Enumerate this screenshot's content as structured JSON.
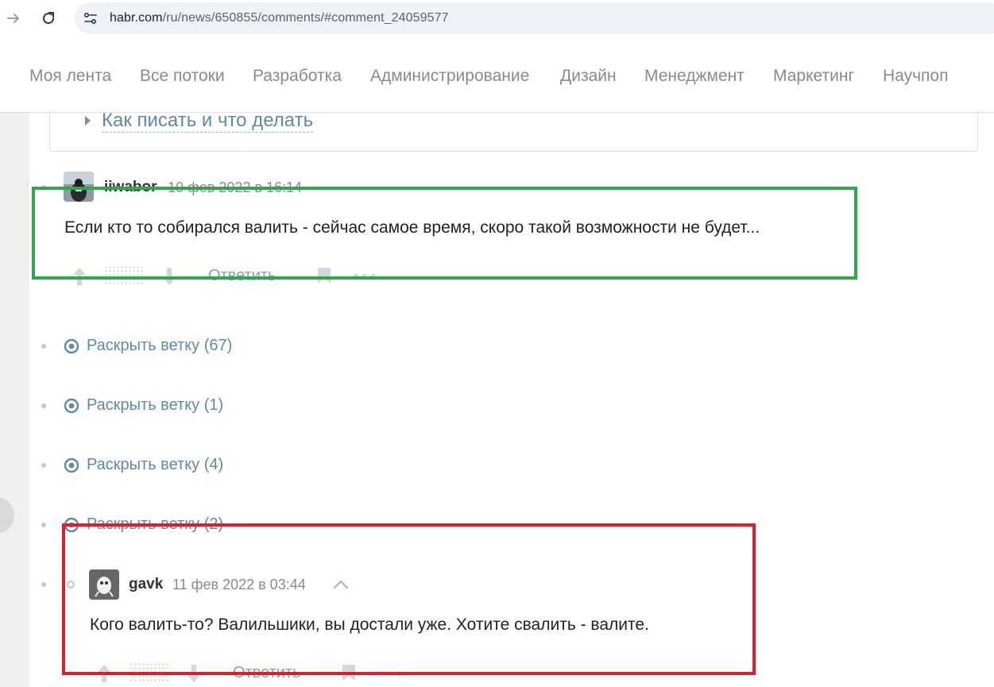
{
  "browser": {
    "url_host": "habr.com",
    "url_path": "/ru/news/650855/comments/#comment_24059577"
  },
  "site_nav": {
    "items": [
      "Моя лента",
      "Все потоки",
      "Разработка",
      "Администрирование",
      "Дизайн",
      "Менеджмент",
      "Маркетинг",
      "Научпоп"
    ]
  },
  "rules": {
    "link_label": "Как писать и что делать"
  },
  "comments": [
    {
      "author": "iiwabor",
      "date": "10 фев 2022 в 16:14",
      "text": "Если кто то собирался валить - сейчас самое время, скоро такой возможности не будет...",
      "reply_label": "Ответить"
    },
    {
      "author": "gavk",
      "date": "11 фев 2022 в 03:44",
      "text": "Кого валить-то? Валильшики, вы достали уже. Хотите свалить - валите.",
      "reply_label": "Ответить"
    }
  ],
  "branches": [
    {
      "label": "Раскрыть ветку (67)"
    },
    {
      "label": "Раскрыть ветку (1)"
    },
    {
      "label": "Раскрыть ветку (4)"
    },
    {
      "label": "Раскрыть ветку (2)"
    }
  ],
  "colors": {
    "link": "#5e8aa6",
    "highlight_green": "#2ea84a",
    "highlight_red": "#dc1e2d"
  },
  "icons": [
    "arrow-forward-icon",
    "reload-icon",
    "site-info-icon",
    "caret-right-icon",
    "vote-up-icon",
    "vote-down-icon",
    "bookmark-icon",
    "more-icon",
    "expand-branch-icon",
    "chevron-up-icon"
  ]
}
